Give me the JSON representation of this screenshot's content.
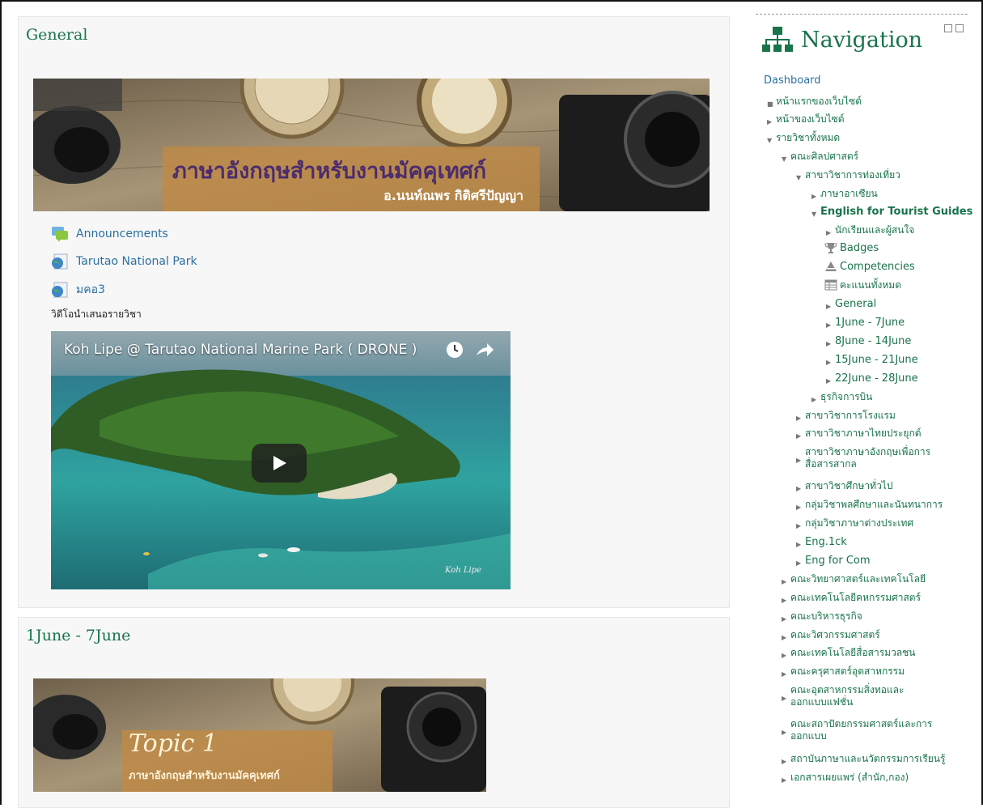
{
  "main": {
    "sections": [
      {
        "title": "General",
        "banner_title": "ภาษาอังกฤษสำหรับงานมัคคุเทศก์",
        "banner_author": "อ.นนท์ณพร กิติศรีปัญญา",
        "activities": [
          {
            "label": "Announcements",
            "icon": "forum-icon"
          },
          {
            "label": "Tarutao National Park",
            "icon": "url-globe-icon"
          },
          {
            "label": "มคอ3",
            "icon": "url-globe-icon"
          }
        ],
        "text_label": "วิดีโอนำเสนอรายวิชา",
        "video": {
          "title": "Koh Lipe @ Tarutao National Marine Park ( DRONE )",
          "watermark": "Koh Lipe"
        }
      },
      {
        "title": "1June - 7June",
        "banner_topic": "Topic 1",
        "banner_subtitle": "ภาษาอังกฤษสำหรับงานมัคคุเทศก์"
      }
    ]
  },
  "navigation": {
    "title": "Navigation",
    "dashboard": "Dashboard",
    "items": [
      {
        "label": "หน้าแรกของเว็บไซต์",
        "marker": "square"
      },
      {
        "label": "หน้าของเว็บไซต์",
        "marker": "collapsed"
      },
      {
        "label": "รายวิชาทั้งหมด",
        "marker": "expanded"
      },
      {
        "label": "คณะศิลปศาสตร์",
        "marker": "expanded"
      },
      {
        "label": "สาขาวิชาการท่องเที่ยว",
        "marker": "expanded"
      },
      {
        "label": "ภาษาอาเซียน",
        "marker": "collapsed"
      },
      {
        "label": "English for Tourist Guides",
        "marker": "expanded"
      },
      {
        "label": "นักเรียนและผู้สนใจ",
        "marker": "collapsed"
      },
      {
        "label": "Badges",
        "icon": "trophy-icon"
      },
      {
        "label": "Competencies",
        "icon": "competency-icon"
      },
      {
        "label": "คะแนนทั้งหมด",
        "icon": "grades-table-icon"
      },
      {
        "label": "General",
        "marker": "collapsed"
      },
      {
        "label": "1June - 7June",
        "marker": "collapsed"
      },
      {
        "label": "8June - 14June",
        "marker": "collapsed"
      },
      {
        "label": "15June - 21June",
        "marker": "collapsed"
      },
      {
        "label": "22June - 28June",
        "marker": "collapsed"
      },
      {
        "label": "ธุรกิจการบิน",
        "marker": "collapsed"
      },
      {
        "label": "สาขาวิชาการโรงแรม",
        "marker": "collapsed"
      },
      {
        "label": "สาขาวิชาภาษาไทยประยุกต์",
        "marker": "collapsed"
      },
      {
        "label": "สาขาวิชาภาษาอังกฤษเพื่อการสื่อสารสากล",
        "marker": "collapsed"
      },
      {
        "label": "สาขาวิชาศึกษาทั่วไป",
        "marker": "collapsed"
      },
      {
        "label": "กลุ่มวิชาพลศึกษาและนันทนาการ",
        "marker": "collapsed"
      },
      {
        "label": "กลุ่มวิชาภาษาต่างประเทศ",
        "marker": "collapsed"
      },
      {
        "label": "Eng.1ck",
        "marker": "collapsed"
      },
      {
        "label": "Eng for Com",
        "marker": "collapsed"
      },
      {
        "label": "คณะวิทยาศาสตร์และเทคโนโลยี",
        "marker": "collapsed"
      },
      {
        "label": "คณะเทคโนโลยีคหกรรมศาสตร์",
        "marker": "collapsed"
      },
      {
        "label": "คณะบริหารธุรกิจ",
        "marker": "collapsed"
      },
      {
        "label": "คณะวิศวกรรมศาสตร์",
        "marker": "collapsed"
      },
      {
        "label": "คณะเทคโนโลยีสื่อสารมวลชน",
        "marker": "collapsed"
      },
      {
        "label": "คณะครุศาสตร์อุตสาหกรรม",
        "marker": "collapsed"
      },
      {
        "label": "คณะอุตสาหกรรมสิ่งทอและออกแบบแฟชั่น",
        "marker": "collapsed"
      },
      {
        "label": "คณะสถาปัตยกรรมศาสตร์และการออกแบบ",
        "marker": "collapsed"
      },
      {
        "label": "สถาบันภาษาและนวัตกรรมการเรียนรู้",
        "marker": "collapsed"
      },
      {
        "label": "เอกสารเผยแพร่ (สำนัก,กอง)",
        "marker": "collapsed"
      }
    ]
  },
  "colors": {
    "link": "#2b6fa0",
    "title_green": "#19744a",
    "banner_text": "#5a3a7a"
  }
}
